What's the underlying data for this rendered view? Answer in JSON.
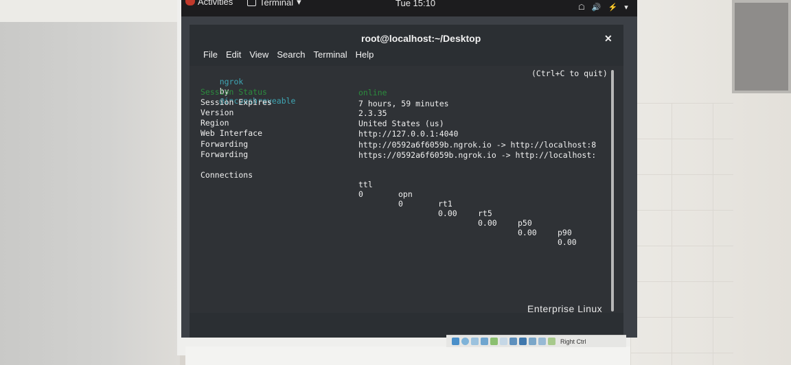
{
  "topbar": {
    "activities": "Activities",
    "app_menu": "Terminal",
    "app_menu_arrow": "▾",
    "clock": "Tue 15:10",
    "tray_icons": [
      "network-icon",
      "volume-icon",
      "power-icon",
      "dropdown-icon"
    ]
  },
  "window": {
    "title": "root@localhost:~/Desktop",
    "close_glyph": "✕"
  },
  "menu": [
    "File",
    "Edit",
    "View",
    "Search",
    "Terminal",
    "Help"
  ],
  "terminal": {
    "header": {
      "app": "ngrok",
      "by": "by",
      "author": "@inconshreveable",
      "quit_hint": "(Ctrl+C to quit)"
    },
    "rows": [
      {
        "label": "Session Status",
        "value": "online"
      },
      {
        "label": "Session Expires",
        "value": "7 hours, 59 minutes"
      },
      {
        "label": "Version",
        "value": "2.3.35"
      },
      {
        "label": "Region",
        "value": "United States (us)"
      },
      {
        "label": "Web Interface",
        "value": "http://127.0.0.1:4040"
      },
      {
        "label": "Forwarding",
        "value": "http://0592a6f6059b.ngrok.io -> http://localhost:8"
      },
      {
        "label": "Forwarding",
        "value": "https://0592a6f6059b.ngrok.io -> http://localhost:"
      }
    ],
    "connections": {
      "label": "Connections",
      "headers": [
        "ttl",
        "opn",
        "rt1",
        "rt5",
        "p50",
        "p90"
      ],
      "values": [
        "0",
        "0",
        "0.00",
        "0.00",
        "0.00",
        "0.00"
      ]
    }
  },
  "brand_text": "Enterprise Linux",
  "vbox": {
    "host_key": "Right Ctrl"
  },
  "colors": {
    "terminal_bg": "#2f3236",
    "ngrok_cyan": "#3fa7b5",
    "status_green": "#2c8d3e",
    "text": "#f0f0f0"
  }
}
